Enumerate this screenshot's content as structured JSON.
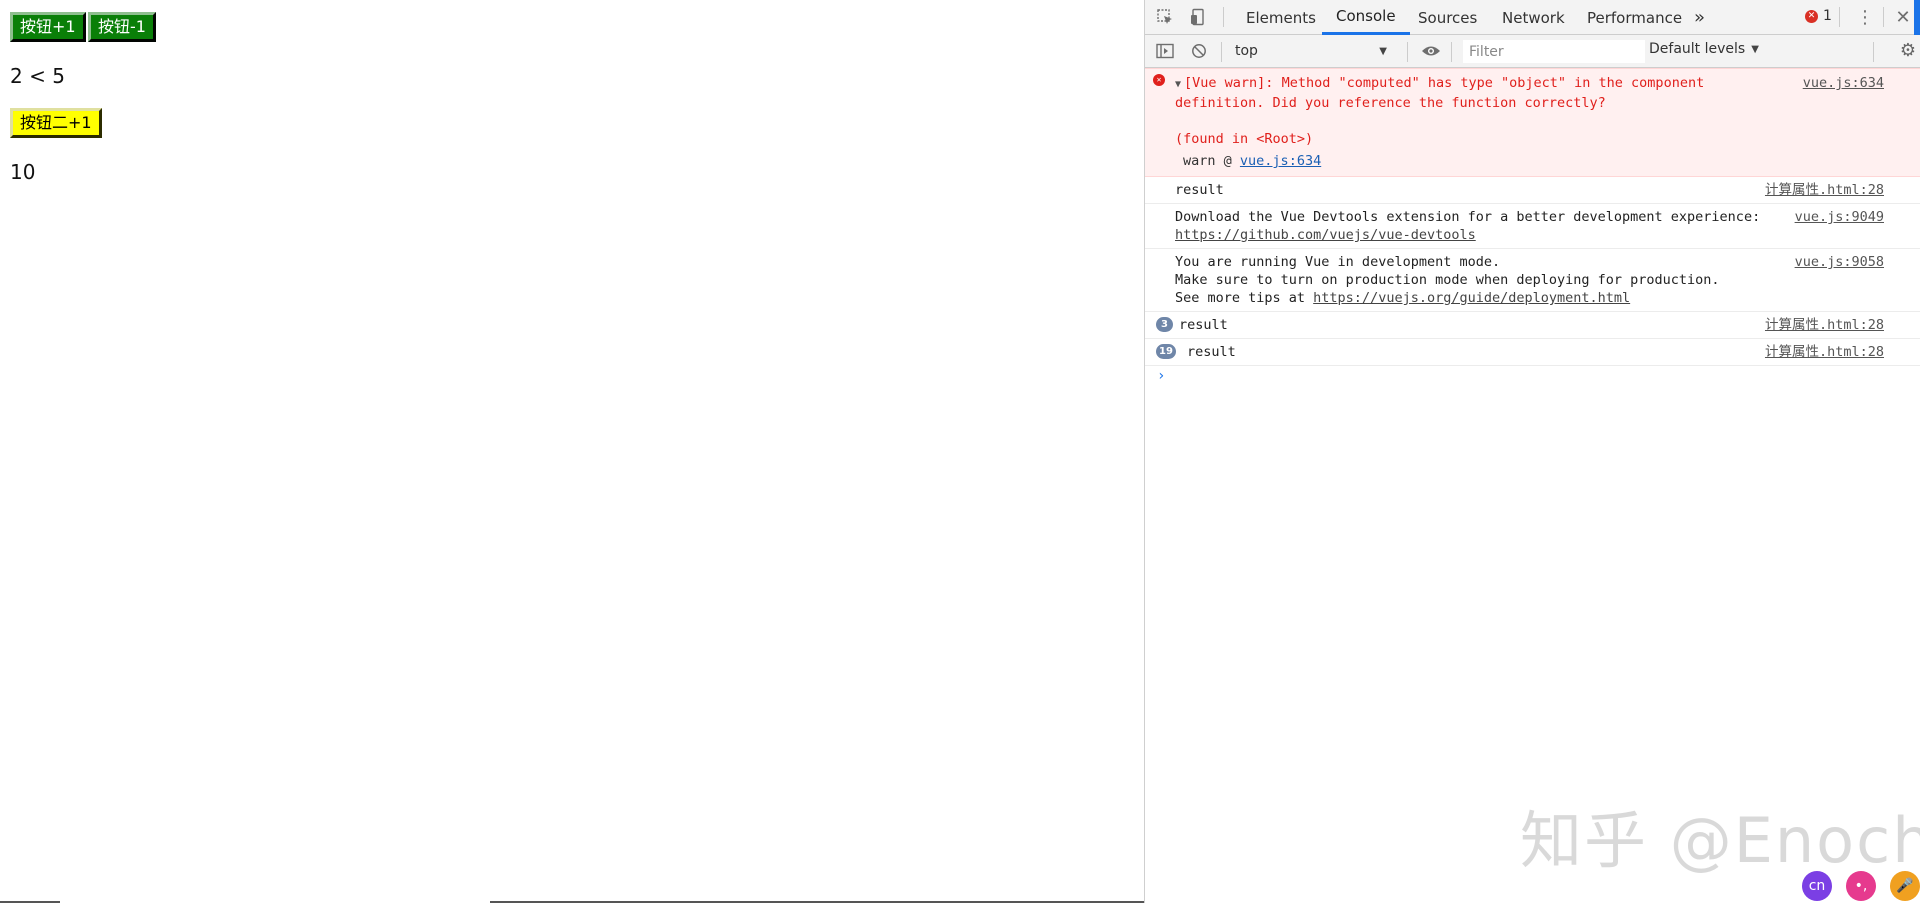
{
  "page": {
    "button1_label": "按钮+1",
    "button2_label": "按钮-1",
    "compare_text": "2 < 5",
    "button3_label": "按钮二+1",
    "value_text": "10",
    "watermark": "知乎 @Enoch"
  },
  "devtools": {
    "tabs": [
      "Elements",
      "Console",
      "Sources",
      "Network",
      "Performance"
    ],
    "active_tab": "Console",
    "more_tabs": "»",
    "error_count": "1",
    "context": "top",
    "filter_placeholder": "Filter",
    "levels_label": "Default levels"
  },
  "console": {
    "error": {
      "text": "[Vue warn]: Method \"computed\" has type \"object\" in the component definition. Did you reference the function correctly?",
      "found": "(found in <Root>)",
      "warn_prefix": "warn @",
      "warn_link": "vue.js:634",
      "source": "vue.js:634"
    },
    "messages": [
      {
        "count": "",
        "lines": [
          "result"
        ],
        "source": "计算属性.html:28"
      },
      {
        "count": "",
        "lines": [
          "Download the Vue Devtools extension for a better development experience:"
        ],
        "link": "https://github.com/vuejs/vue-devtools",
        "source": "vue.js:9049"
      },
      {
        "count": "",
        "lines": [
          "You are running Vue in development mode.",
          "Make sure to turn on production mode when deploying for production."
        ],
        "prefix": "See more tips at ",
        "link": "https://vuejs.org/guide/deployment.html",
        "source": "vue.js:9058"
      },
      {
        "count": "3",
        "lines": [
          "result"
        ],
        "source": "计算属性.html:28"
      },
      {
        "count": "19",
        "lines": [
          "result"
        ],
        "source": "计算属性.html:28"
      }
    ],
    "prompt": "›"
  },
  "taskbar_icons": [
    {
      "label": "cn",
      "color": "#7b3fe4"
    },
    {
      "label": "•,",
      "color": "#e63a8e"
    },
    {
      "label": "🎤",
      "color": "#f0a020"
    }
  ],
  "colors": {
    "button_green": "#0a7f08",
    "button_yellow": "#ffff00",
    "error_red": "#e0201c",
    "accent_blue": "#1a73e8"
  }
}
